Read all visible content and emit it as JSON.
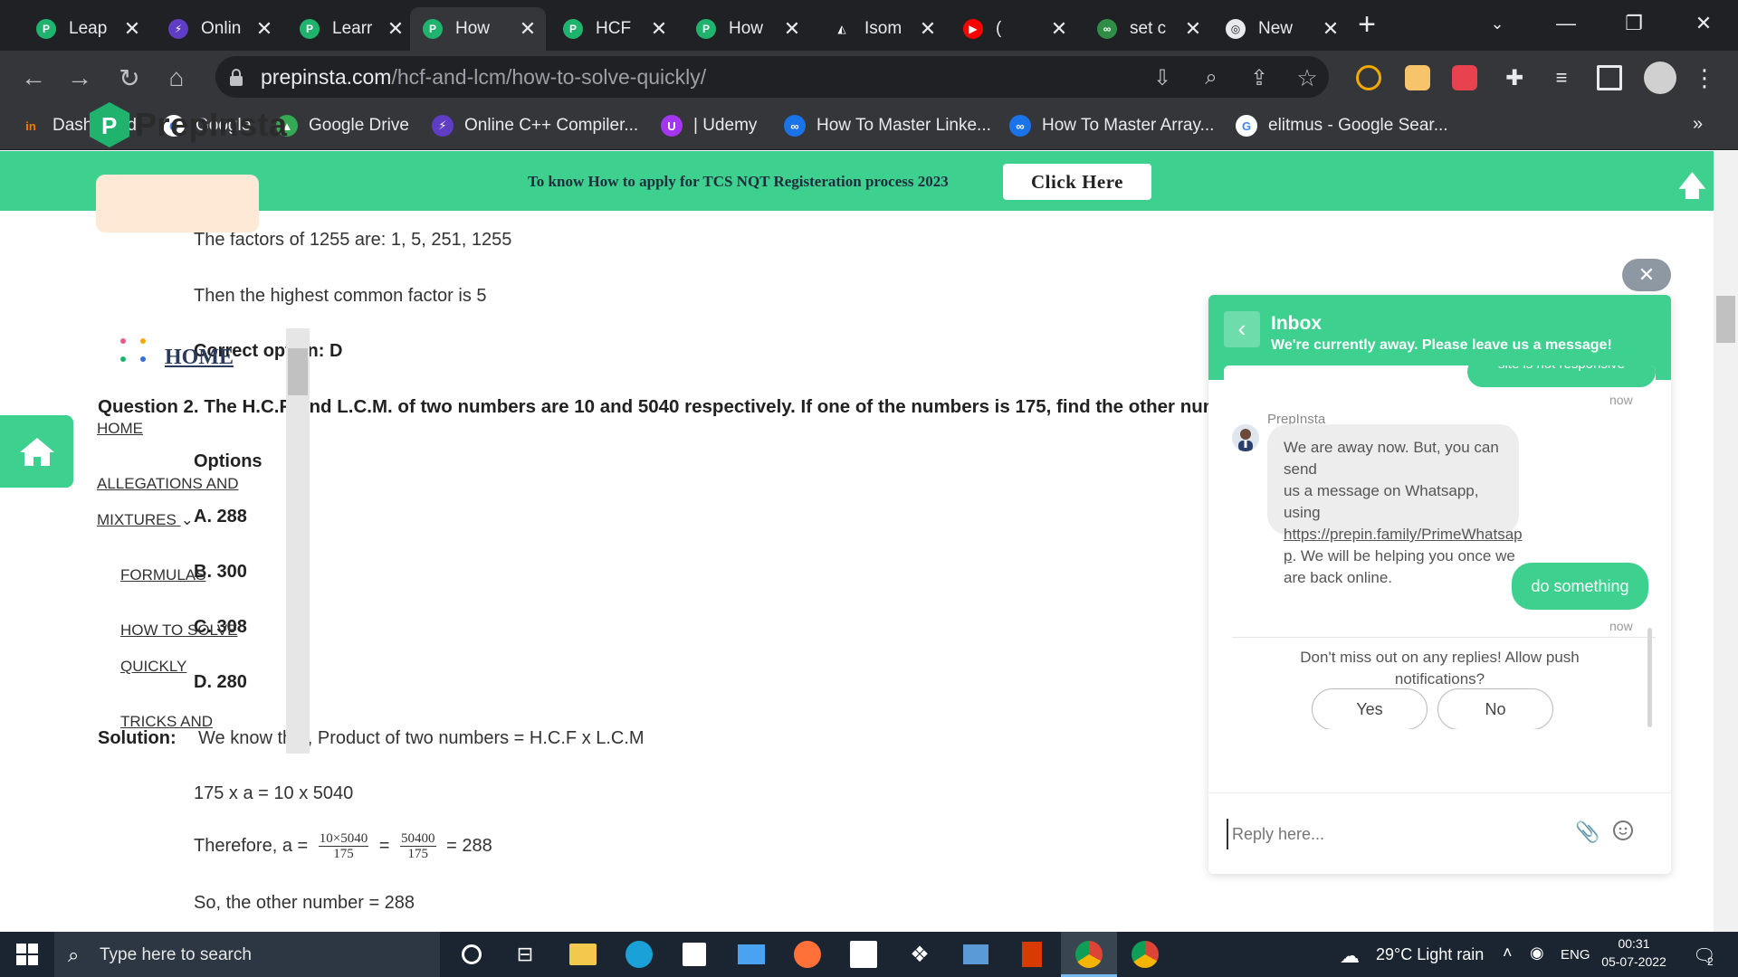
{
  "browser": {
    "tabs": [
      {
        "label": "Leap",
        "icon": "prepinsta-icon"
      },
      {
        "label": "Onlin",
        "icon": "bolt-icon"
      },
      {
        "label": "Learr",
        "icon": "prepinsta-icon"
      },
      {
        "label": "How",
        "icon": "prepinsta-icon"
      },
      {
        "label": "HCF",
        "icon": "prepinsta-icon"
      },
      {
        "label": "How",
        "icon": "prepinsta-icon"
      },
      {
        "label": "Isom",
        "icon": "leetcode-icon"
      },
      {
        "label": "(",
        "icon": "youtube-icon"
      },
      {
        "label": "set c",
        "icon": "gfg-icon"
      },
      {
        "label": "New",
        "icon": "chrome-icon"
      }
    ],
    "url_domain": "prepinsta.com",
    "url_path": "/hcf-and-lcm/how-to-solve-quickly/",
    "bookmarks": [
      {
        "label": "Dashboard"
      },
      {
        "label": "Google"
      },
      {
        "label": "Google Drive"
      },
      {
        "label": "Online C++ Compiler..."
      },
      {
        "label": "| Udemy"
      },
      {
        "label": "How To Master Linke..."
      },
      {
        "label": "How To Master Array..."
      },
      {
        "label": "elitmus - Google Sear..."
      }
    ]
  },
  "banner": {
    "text": "To know How to apply for TCS NQT Registeration process 2023",
    "button": "Click Here"
  },
  "sidebar": {
    "logo": "PrepInsta",
    "home_chip": "HOME",
    "links": [
      "HOME",
      "ALLEGATIONS AND",
      "MIXTURES",
      "FORMULAS",
      "HOW TO SOLVE",
      "QUICKLY",
      "TRICKS AND"
    ]
  },
  "content": {
    "factors_line": "The factors of 1255 are: 1, 5, 251, 1255",
    "hcf_line": "Then the highest common factor is 5",
    "correct_option": "Correct option: D",
    "question": "Question 2.  The H.C.F. and L.C.M. of two numbers are 10 and 5040 respectively. If one of the numbers is 175, find the other num",
    "options_label": "Options",
    "options": [
      "A. 288",
      "B. 300",
      "C. 308",
      "D. 280"
    ],
    "solution_label": "Solution:",
    "solution_text": "We know that, Product of two numbers = H.C.F x L.C.M",
    "eq1": "175 x a = 10 x 5040",
    "eq2_prefix": "Therefore, a =",
    "frac1_num": "10×5040",
    "frac1_den": "175",
    "frac2_num": "50400",
    "frac2_den": "175",
    "eq2_equals": "=",
    "eq2_result": "= 288",
    "conclusion": "So, the other number = 288"
  },
  "chat": {
    "title": "Inbox",
    "subtitle": "We're currently away. Please leave us a message!",
    "prev_msg": "site is not responsive",
    "ts1": "now",
    "agent_name": "PrepInsta",
    "agent_msg_1": "We are away now. But, you can send",
    "agent_msg_2": "us a message on Whatsapp, using",
    "agent_link_1": "https://prepin.family/PrimeWhatsap",
    "agent_link_2": "p",
    "agent_msg_3": ". We will be helping you once we",
    "agent_msg_4": "are back online.",
    "user_msg": "do something",
    "ts2": "now",
    "push_prompt_1": "Don't miss out on any replies! Allow push",
    "push_prompt_2": "notifications?",
    "yes": "Yes",
    "no": "No",
    "reply_placeholder": "Reply here..."
  },
  "taskbar": {
    "search_placeholder": "Type here to search",
    "weather": "29°C  Light rain",
    "language": "ENG",
    "time": "00:31",
    "date": "05-07-2022",
    "notification_count": "2"
  },
  "colors": {
    "brand_green": "#3ed08f",
    "chrome_dark": "#202124",
    "chrome_toolbar": "#35363a",
    "taskbar": "#1b2531"
  }
}
